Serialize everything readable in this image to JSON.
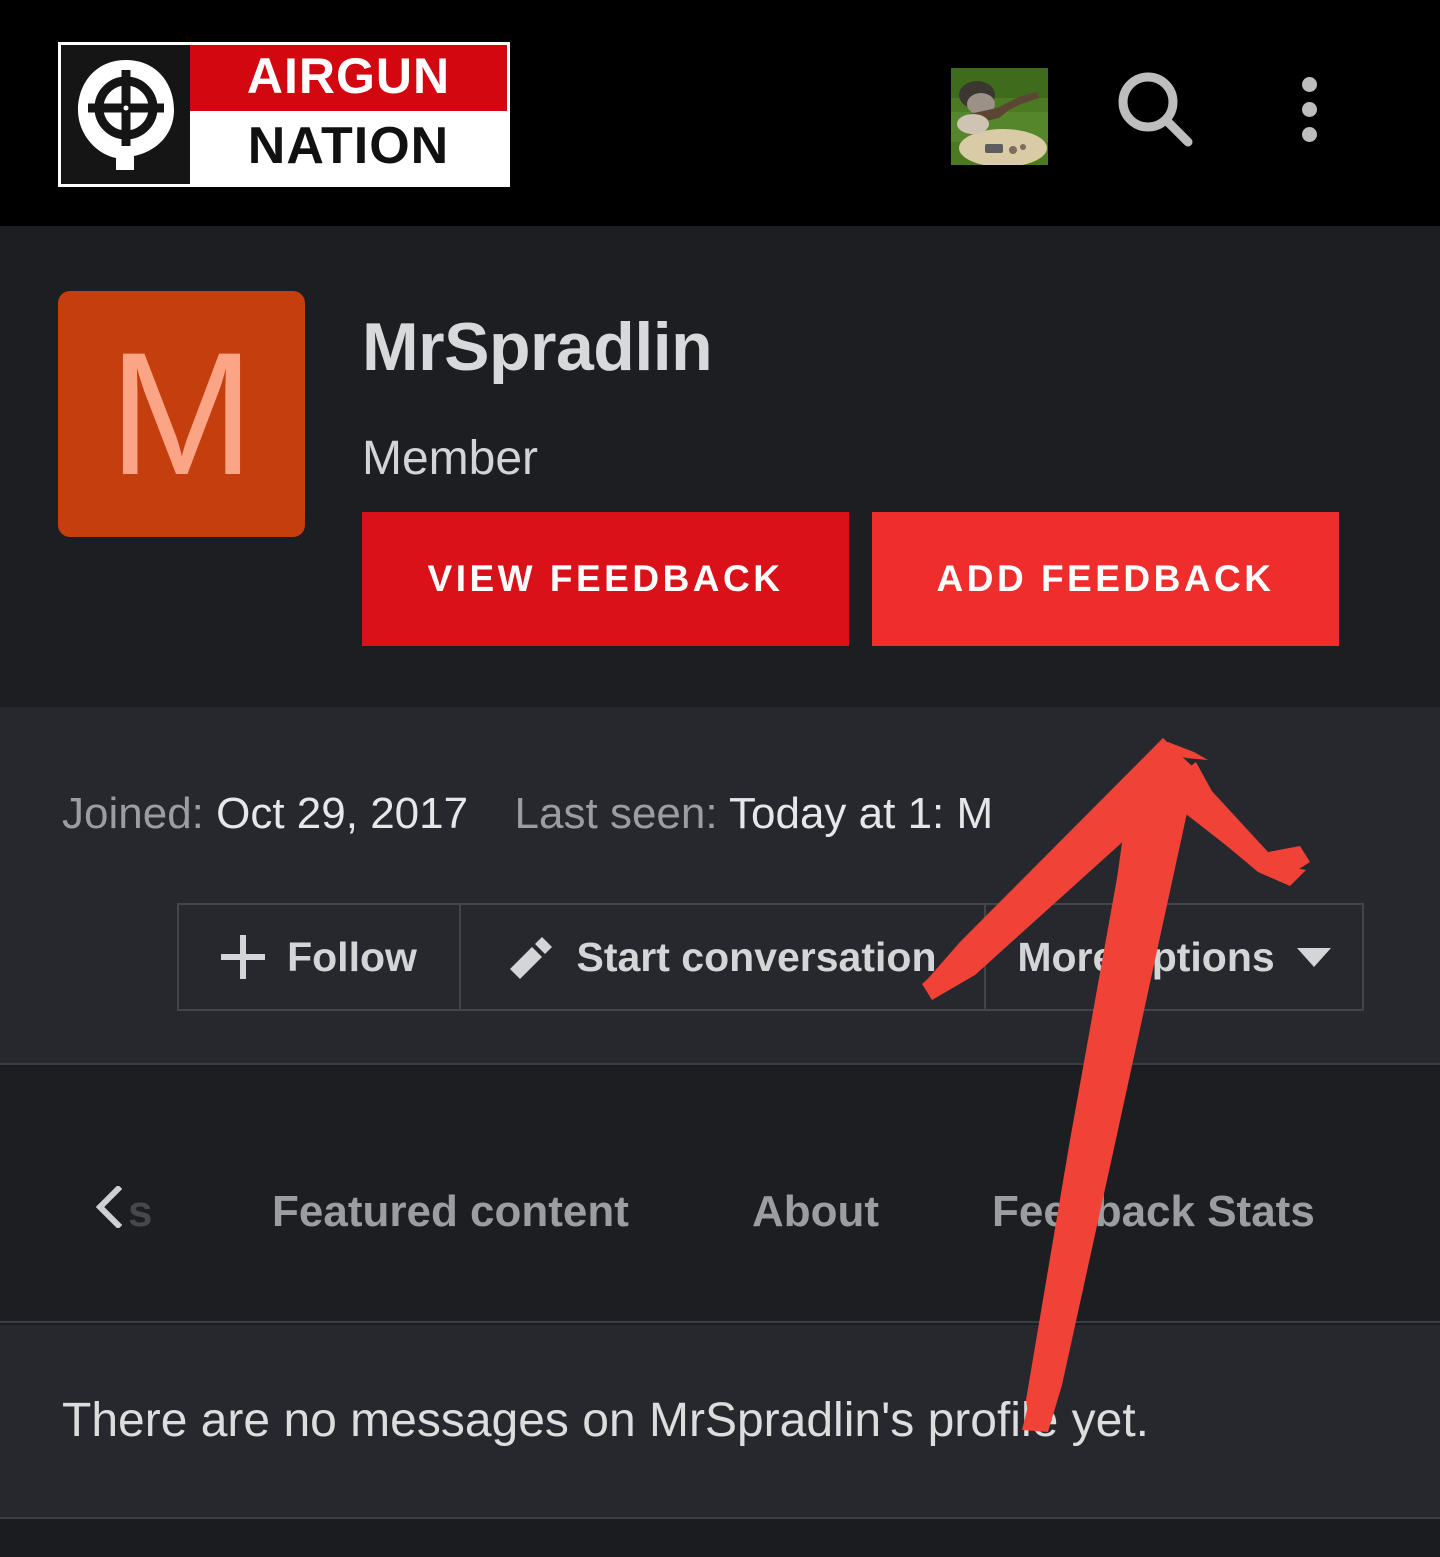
{
  "appbar": {
    "logo": {
      "word_top": "AIRGUN",
      "word_bottom": "NATION",
      "mark_icon": "crosshair-target-icon",
      "red": "#d2070f"
    },
    "user_avatar_icon": "user-avatar-thumbnail",
    "search_icon": "search-icon",
    "overflow_icon": "kebab-menu-icon"
  },
  "profile": {
    "avatar_letter": "M",
    "avatar_bg": "#c53e0d",
    "avatar_letter_color": "#fca486",
    "username": "MrSpradlin",
    "user_title": "Member",
    "buttons": [
      {
        "label": "VIEW FEEDBACK",
        "color": "#da1119"
      },
      {
        "label": "ADD FEEDBACK",
        "color": "#ef2d2d"
      }
    ]
  },
  "info": {
    "joined_label": "Joined:",
    "joined_value": "Oct 29, 2017",
    "last_seen_label": "Last seen:",
    "last_seen_value": "Today at 1:  M",
    "actions": [
      {
        "label": "Follow",
        "icon": "plus-icon"
      },
      {
        "label": "Start conversation",
        "icon": "pencil-icon"
      },
      {
        "label": "More options",
        "icon": "chevron-down-icon"
      }
    ]
  },
  "tabs": {
    "scroll_left_icon": "chevron-left-icon",
    "truncated_tab": "s",
    "items": [
      {
        "label": "Featured content"
      },
      {
        "label": "About"
      },
      {
        "label": "Feedback Stats"
      }
    ]
  },
  "message": {
    "empty_text": "There are no messages on MrSpradlin's profile yet."
  },
  "annotation": {
    "shape": "hand-drawn-up-arrow",
    "color": "#f04237"
  }
}
